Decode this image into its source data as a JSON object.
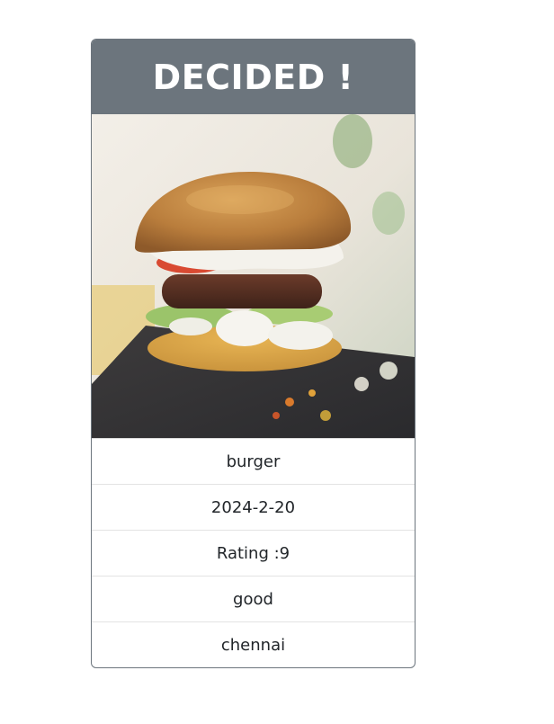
{
  "card": {
    "title": "DECIDED !",
    "image_subject": "burger",
    "details": [
      "burger",
      "2024-2-20",
      "Rating :9",
      "good",
      "chennai"
    ]
  },
  "colors": {
    "header_background": "#6c757d",
    "header_text": "#ffffff",
    "card_border": "#6c757d",
    "text": "#212529"
  }
}
